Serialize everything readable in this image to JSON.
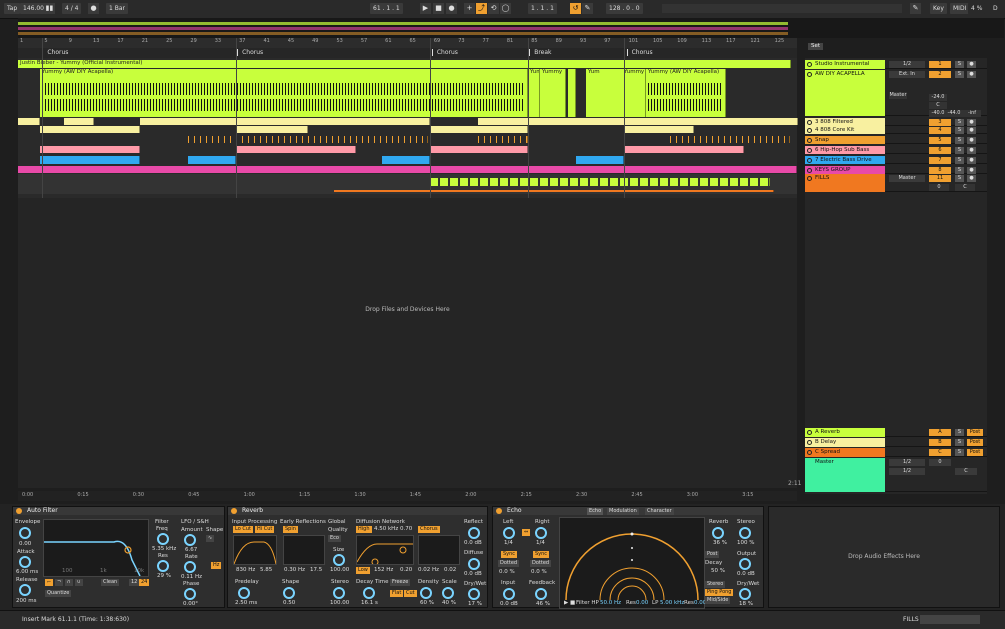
{
  "transport": {
    "tap": "Tap",
    "tempo": "146.00",
    "meter": "4 / 4",
    "quant": "1 Bar",
    "position": "61 .  1 .  1",
    "loop_start": "1 .  1 .  1",
    "loop_len": "128 .  0 .  0",
    "key": "Key",
    "midi": "MIDI",
    "cpu": "4 %",
    "d": "D"
  },
  "ruler": {
    "ticks": [
      "1",
      "5",
      "9",
      "13",
      "17",
      "21",
      "25",
      "29",
      "33",
      "37",
      "41",
      "45",
      "49",
      "53",
      "57",
      "61",
      "65",
      "69",
      "73",
      "77",
      "81",
      "85",
      "89",
      "93",
      "97",
      "101",
      "105",
      "109",
      "113",
      "117",
      "121",
      "125"
    ]
  },
  "locators": [
    {
      "label": "Chorus",
      "bar": 5
    },
    {
      "label": "Chorus",
      "bar": 37
    },
    {
      "label": "Chorus",
      "bar": 69
    },
    {
      "label": "Break",
      "bar": 85
    },
    {
      "label": "Chorus",
      "bar": 101
    }
  ],
  "arrangement": {
    "instrumental_clip": "Justin Bieber - Yummy (Official Instrumental)",
    "acapella_clip": "Yummy (AW DIY Acapella)",
    "acapella_short": "Yum",
    "acapella_mid": "Yummy",
    "drop_text": "Drop Files and Devices Here",
    "end_marker": "2:11"
  },
  "timebar": [
    "0:00",
    "0:15",
    "0:30",
    "0:45",
    "1:00",
    "1:15",
    "1:30",
    "1:45",
    "2:00",
    "2:15",
    "2:30",
    "2:45",
    "3:00",
    "3:15"
  ],
  "mixer": {
    "set": "Set",
    "tracks": [
      {
        "name": "Studio Instrumental",
        "color": "#c8ff3c",
        "io": "1/2",
        "num": "1",
        "s": "S"
      },
      {
        "name": "AW DIY ACAPELLA",
        "color": "#c8ff3c",
        "io": "Ext. In",
        "num": "2",
        "s": "S"
      },
      {
        "name": "3 808 Filtered",
        "color": "#f8f0a0",
        "io": "",
        "num": "3",
        "s": "S"
      },
      {
        "name": "4 808 Core Kit",
        "color": "#f8f0a0",
        "io": "",
        "num": "4",
        "s": "S"
      },
      {
        "name": "Snap",
        "color": "#f0a030",
        "io": "",
        "num": "5",
        "s": "S"
      },
      {
        "name": "6 Hip-Hop Sub Bass",
        "color": "#ff9aa8",
        "io": "",
        "num": "6",
        "s": "S"
      },
      {
        "name": "7 Electric Bass Drive",
        "color": "#30a8f0",
        "io": "",
        "num": "7",
        "s": "S"
      },
      {
        "name": "KEYS GROUP",
        "color": "#e84aa8",
        "io": "",
        "num": "8",
        "s": "S"
      },
      {
        "name": "FILLS",
        "color": "#f07820",
        "io": "Master",
        "num": "11",
        "s": "S"
      }
    ],
    "acap_extra": {
      "master": "Master",
      "vol": "-24.0",
      "c": "C",
      "l": "-40.0",
      "r": "-44.0",
      "inf": "-inf"
    },
    "fills_extra": {
      "zero": "0",
      "c": "C"
    },
    "returns": [
      {
        "name": "A Reverb",
        "color": "#c8ff3c",
        "num": "A",
        "s": "S",
        "post": "Post"
      },
      {
        "name": "B Delay",
        "color": "#f8f0a0",
        "num": "B",
        "s": "S",
        "post": "Post"
      },
      {
        "name": "C Spread",
        "color": "#f07820",
        "num": "C",
        "s": "S",
        "post": "Post"
      }
    ],
    "master": {
      "name": "Master",
      "io1": "1/2",
      "io2": "1/2",
      "zero": "0",
      "c": "C"
    }
  },
  "autofilter": {
    "title": "Auto Filter",
    "envelope": "Envelope",
    "env_val": "0.00",
    "attack": "Attack",
    "attack_val": "6.00 ms",
    "release": "Release",
    "release_val": "200 ms",
    "filter": "Filter",
    "freq": "Freq",
    "freq_val": "5.35 kHz",
    "res": "Res",
    "res_val": "29 %",
    "lfo": "LFO / S&H",
    "amount": "Amount",
    "amount_val": "6.67",
    "rate": "Rate",
    "rate_val": "0.11 Hz",
    "phase": "Phase",
    "phase_val": "0.00°",
    "shape": "Shape",
    "clean": "Clean",
    "quantize": "Quantize",
    "g100": "100",
    "g1k": "1k",
    "g10k": "10k",
    "q12": "12",
    "q24": "24"
  },
  "reverb": {
    "title": "Reverb",
    "input": "Input Processing",
    "locut": "Lo Cut",
    "hicut": "Hi Cut",
    "in_freq": "830 Hz",
    "in_w": "5.85",
    "early": "Early Reflections",
    "spin": "Spin",
    "spin_rate": "0.30 Hz",
    "spin_amt": "17.5",
    "global": "Global",
    "quality": "Quality",
    "eco": "Eco",
    "size": "Size",
    "size_val": "100.00",
    "predelay": "Predelay",
    "predelay_val": "2.50 ms",
    "shape": "Shape",
    "shape_val": "0.50",
    "stereo": "Stereo",
    "stereo_val": "100.00",
    "diffusion": "Diffusion Network",
    "high": "High",
    "chorus": "Chorus",
    "hfreq": "4.50 kHz",
    "hval": "0.70",
    "low": "Low",
    "lfreq": "152 Hz",
    "lval": "0.20",
    "cval": "0.02 Hz",
    "cval2": "0.02",
    "decay": "Decay Time",
    "decay_val": "16.1 s",
    "freeze": "Freeze",
    "flat": "Flat",
    "cut": "Cut",
    "density": "Density",
    "density_val": "60 %",
    "scale": "Scale",
    "scale_val": "40 %",
    "reflect": "Reflect",
    "reflect_val": "0.0 dB",
    "diffuse": "Diffuse",
    "diffuse_val": "0.0 dB",
    "drywet": "Dry/Wet",
    "drywet_val": "17 %"
  },
  "echo": {
    "title": "Echo",
    "tab_echo": "Echo",
    "tab_mod": "Modulation",
    "tab_char": "Character",
    "left": "Left",
    "right": "Right",
    "left_val": "1/4",
    "right_val": "1/4",
    "sync": "Sync",
    "dotted": "Dotted",
    "pct": "0.0 %",
    "input": "Input",
    "input_val": "0.0 dB",
    "feedback": "Feedback",
    "feedback_val": "46 %",
    "filter_hp": "Filter HP",
    "hp_val": "50.0 Hz",
    "res": "Res",
    "res_val": "0.00",
    "lp": "LP",
    "lp_val": "5.00 kHz",
    "res_val2": "0.00",
    "reverb": "Reverb",
    "reverb_val": "36 %",
    "stereo": "Stereo",
    "stereo_val": "100 %",
    "post": "Post",
    "decay": "Decay",
    "decay_val": "50 %",
    "output": "Output",
    "output_val": "0.0 dB",
    "stereo_btn": "Stereo",
    "pingpong": "Ping Pong",
    "midside": "Mid/Side",
    "drywet": "Dry/Wet",
    "drywet_val": "18 %"
  },
  "drop_effects": "Drop Audio Effects Here",
  "status": {
    "text": "Insert Mark 61.1.1 (Time: 1:38:630)",
    "fills": "FILLS"
  }
}
